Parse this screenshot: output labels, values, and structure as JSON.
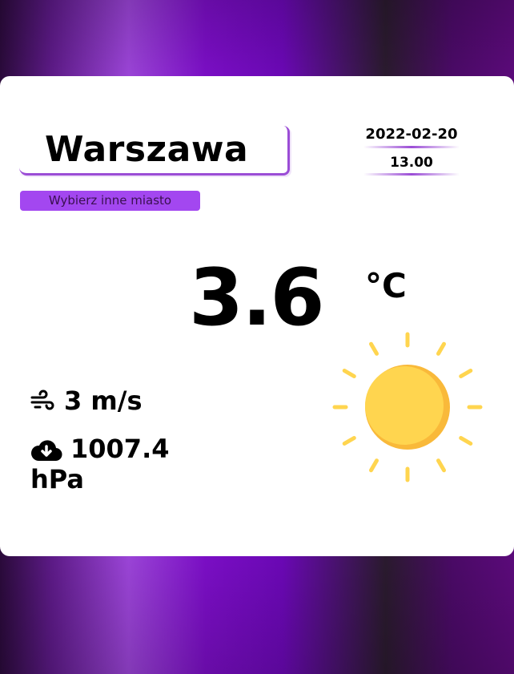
{
  "city": {
    "name": "Warszawa"
  },
  "choose_city_button": {
    "label": "Wybierz inne miasto"
  },
  "datetime": {
    "date": "2022-02-20",
    "time": "13.00"
  },
  "weather": {
    "temperature": "3.6",
    "unit": "°C",
    "condition_icon": "sun-icon",
    "wind": "3 m/s",
    "wind_icon": "wind-icon",
    "pressure_value": "1007.4",
    "pressure_unit": "hPa",
    "pressure_icon": "cloud-download-icon"
  },
  "colors": {
    "accent": "#9b4dd6",
    "button_bg": "#a347f0",
    "sun_main": "#ffd54f",
    "sun_shadow": "#f9b93a",
    "rays": "#ffd54f"
  }
}
